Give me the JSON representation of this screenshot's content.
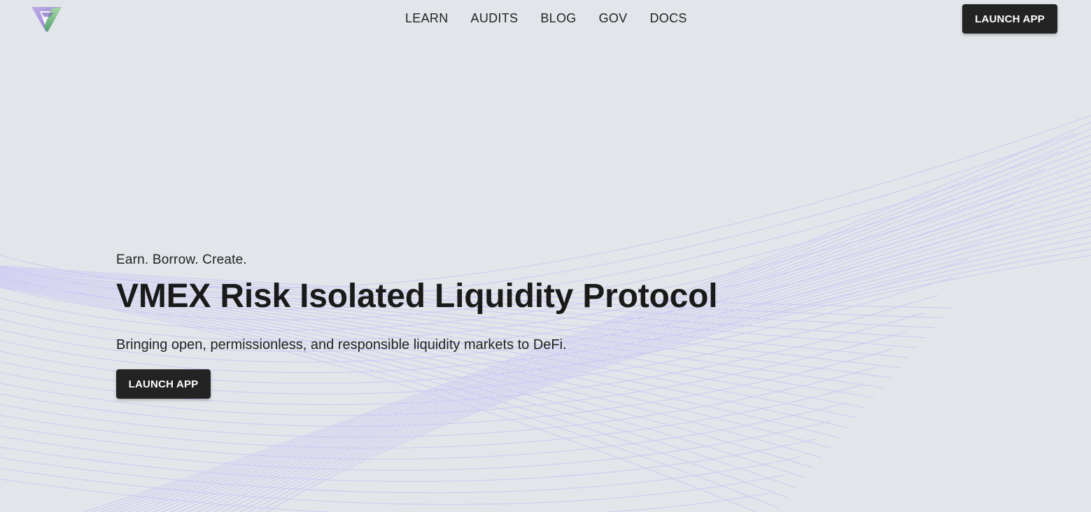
{
  "colors": {
    "background": "#e2e5e9",
    "button": "#232323",
    "button_text": "#ffffff",
    "line_accent": "#c9c6f7"
  },
  "header": {
    "logo_icon": "vmex-triangle-logo",
    "nav": [
      {
        "label": "LEARN"
      },
      {
        "label": "AUDITS"
      },
      {
        "label": "BLOG"
      },
      {
        "label": "GOV"
      },
      {
        "label": "DOCS"
      }
    ],
    "launch_label": "LAUNCH APP"
  },
  "hero": {
    "tagline": "Earn. Borrow. Create.",
    "title": "VMEX Risk Isolated Liquidity Protocol",
    "subtitle": "Bringing open, permissionless, and responsible liquidity markets to DeFi.",
    "launch_label": "LAUNCH APP"
  }
}
